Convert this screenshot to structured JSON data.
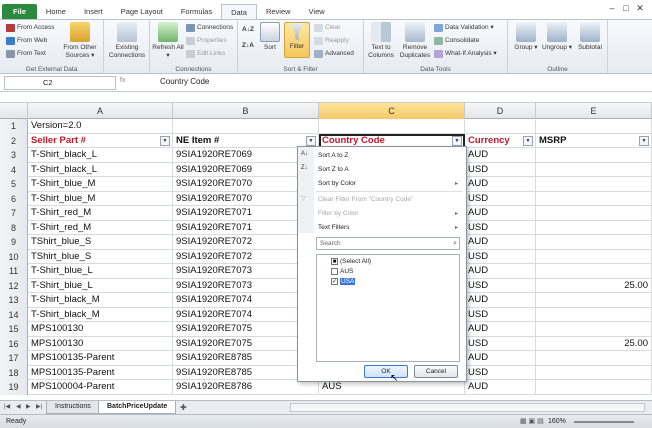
{
  "window_controls": [
    "‒",
    "□",
    "✕"
  ],
  "ribbon_tabs": [
    "File",
    "Home",
    "Insert",
    "Page Layout",
    "Formulas",
    "Data",
    "Review",
    "View"
  ],
  "ribbon": {
    "get_external_data": {
      "label": "Get External Data",
      "from_access": "From Access",
      "from_web": "From Web",
      "from_text": "From Text",
      "from_other_sources": "From Other Sources ▾"
    },
    "connections_group": {
      "label": "Connections",
      "existing_connections": "Existing Connections",
      "refresh_all": "Refresh All ▾",
      "connections": "Connections",
      "properties": "Properties",
      "edit_links": "Edit Links"
    },
    "sort_filter": {
      "label": "Sort & Filter",
      "sort_az": "A↓Z",
      "sort_za": "Z↓A",
      "sort": "Sort",
      "filter": "Filter",
      "clear": "Clear",
      "reapply": "Reapply",
      "advanced": "Advanced"
    },
    "data_tools": {
      "label": "Data Tools",
      "text_to_columns": "Text to Columns",
      "remove_duplicates": "Remove Duplicates",
      "data_validation": "Data Validation ▾",
      "consolidate": "Consolidate",
      "what_if": "What-If Analysis ▾"
    },
    "outline": {
      "label": "Outline",
      "group": "Group ▾",
      "ungroup": "Ungroup ▾",
      "subtotal": "Subtotal"
    }
  },
  "formula_bar": {
    "name_box": "C2",
    "fx": "fx",
    "content": "Country Code"
  },
  "columns": [
    "A",
    "B",
    "C",
    "D",
    "E"
  ],
  "rows": [
    {
      "n": "1",
      "a": "Version=2.0",
      "b": "",
      "c": "",
      "d": "",
      "e": ""
    },
    {
      "n": "2",
      "a": "Seller Part #",
      "b": "NE Item #",
      "c": "Country Code",
      "d": "Currency",
      "e": "MSRP"
    },
    {
      "n": "3",
      "a": "T-Shirt_black_L",
      "b": "9SIA1920RE7069",
      "c": "",
      "d": "AUD",
      "e": ""
    },
    {
      "n": "4",
      "a": "T-Shirt_black_L",
      "b": "9SIA1920RE7069",
      "c": "",
      "d": "USD",
      "e": ""
    },
    {
      "n": "5",
      "a": "T-Shirt_blue_M",
      "b": "9SIA1920RE7070",
      "c": "",
      "d": "AUD",
      "e": ""
    },
    {
      "n": "6",
      "a": "T-Shirt_blue_M",
      "b": "9SIA1920RE7070",
      "c": "",
      "d": "USD",
      "e": ""
    },
    {
      "n": "7",
      "a": "T-Shirt_red_M",
      "b": "9SIA1920RE7071",
      "c": "",
      "d": "AUD",
      "e": ""
    },
    {
      "n": "8",
      "a": "T-Shirt_red_M",
      "b": "9SIA1920RE7071",
      "c": "",
      "d": "USD",
      "e": ""
    },
    {
      "n": "9",
      "a": "TShirt_blue_S",
      "b": "9SIA1920RE7072",
      "c": "",
      "d": "AUD",
      "e": ""
    },
    {
      "n": "10",
      "a": "TShirt_blue_S",
      "b": "9SIA1920RE7072",
      "c": "",
      "d": "USD",
      "e": ""
    },
    {
      "n": "11",
      "a": "T-Shirt_blue_L",
      "b": "9SIA1920RE7073",
      "c": "",
      "d": "AUD",
      "e": ""
    },
    {
      "n": "12",
      "a": "T-Shirt_blue_L",
      "b": "9SIA1920RE7073",
      "c": "",
      "d": "USD",
      "e": "25.00"
    },
    {
      "n": "13",
      "a": "T-Shirt_black_M",
      "b": "9SIA1920RE7074",
      "c": "",
      "d": "AUD",
      "e": ""
    },
    {
      "n": "14",
      "a": "T-Shirt_black_M",
      "b": "9SIA1920RE7074",
      "c": "",
      "d": "USD",
      "e": ""
    },
    {
      "n": "15",
      "a": "MPS100130",
      "b": "9SIA1920RE7075",
      "c": "",
      "d": "AUD",
      "e": ""
    },
    {
      "n": "16",
      "a": "MPS100130",
      "b": "9SIA1920RE7075",
      "c": "",
      "d": "USD",
      "e": "25.00"
    },
    {
      "n": "17",
      "a": "MPS100135-Parent",
      "b": "9SIA1920RE8785",
      "c": "",
      "d": "AUD",
      "e": ""
    },
    {
      "n": "18",
      "a": "MPS100135-Parent",
      "b": "9SIA1920RE8785",
      "c": "",
      "d": "USD",
      "e": ""
    },
    {
      "n": "19",
      "a": "MPS100004-Parent",
      "b": "9SIA1920RE8786",
      "c": "AUS",
      "d": "AUD",
      "e": ""
    }
  ],
  "filter_menu": {
    "sort_a_to_z": "Sort A to Z",
    "sort_z_to_a": "Sort Z to A",
    "sort_by_color": "Sort by Color",
    "clear_filter": "Clear Filter From \"Country Code\"",
    "filter_by_color": "Filter by Color",
    "text_filters": "Text Filters",
    "search_placeholder": "Search",
    "items": [
      {
        "label": "(Select All)",
        "check": "■"
      },
      {
        "label": "AUS",
        "check": ""
      },
      {
        "label": "USA",
        "check": "✓"
      }
    ],
    "ok": "OK",
    "cancel": "Cancel"
  },
  "sheet_tabs": [
    "Instructions",
    "BatchPriceUpdate"
  ],
  "status": {
    "ready": "Ready",
    "zoom": "160%"
  },
  "colors": {
    "file_tab": "#2a8a3e",
    "header_red": "#c0172b",
    "selection": "#3875d7"
  }
}
